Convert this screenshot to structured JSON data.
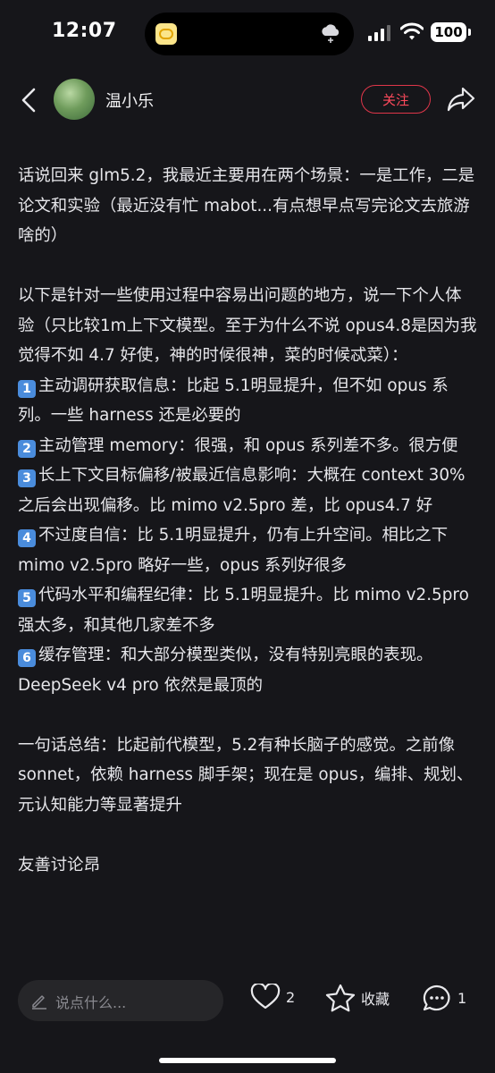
{
  "status": {
    "time": "12:07",
    "battery": "100"
  },
  "header": {
    "username": "温小乐",
    "follow_label": "关注"
  },
  "post": {
    "intro": "话说回来 glm5.2，我最近主要用在两个场景：一是工作，二是论文和实验（最近没有忙 mabot...有点想早点写完论文去旅游啥的）",
    "context": "以下是针对一些使用过程中容易出问题的地方，说一下个人体验（只比较1m上下文模型。至于为什么不说 opus4.8是因为我觉得不如 4.7 好使，神的时候很神，菜的时候忒菜）：",
    "points": [
      {
        "num": "1",
        "text": "主动调研获取信息：比起 5.1明显提升，但不如 opus 系列。一些 harness 还是必要的"
      },
      {
        "num": "2",
        "text": "主动管理 memory：很强，和 opus 系列差不多。很方便"
      },
      {
        "num": "3",
        "text": "长上下文目标偏移/被最近信息影响：大概在 context 30%之后会出现偏移。比 mimo v2.5pro 差，比 opus4.7 好"
      },
      {
        "num": "4",
        "text": "不过度自信：比 5.1明显提升，仍有上升空间。相比之下 mimo v2.5pro 略好一些，opus 系列好很多"
      },
      {
        "num": "5",
        "text": "代码水平和编程纪律：比 5.1明显提升。比 mimo v2.5pro 强太多，和其他几家差不多"
      },
      {
        "num": "6",
        "text": "缓存管理：和大部分模型类似，没有特别亮眼的表现。DeepSeek v4 pro 依然是最顶的"
      }
    ],
    "summary": "一句话总结：比起前代模型，5.2有种长脑子的感觉。之前像 sonnet，依赖 harness 脚手架；现在是 opus，编排、规划、元认知能力等显著提升",
    "closing": "友善讨论昂"
  },
  "bottom": {
    "comment_placeholder": "说点什么...",
    "like_count": "2",
    "favorite_label": "收藏",
    "comment_count": "1"
  },
  "icons": [
    "back-icon",
    "share-icon",
    "heart-icon",
    "star-icon",
    "comment-icon",
    "pencil-icon",
    "cloud-icon",
    "wifi-icon"
  ],
  "colors": {
    "background": "#16161a",
    "follow_accent": "#e0364a",
    "number_badge": "#4a8cdc"
  }
}
